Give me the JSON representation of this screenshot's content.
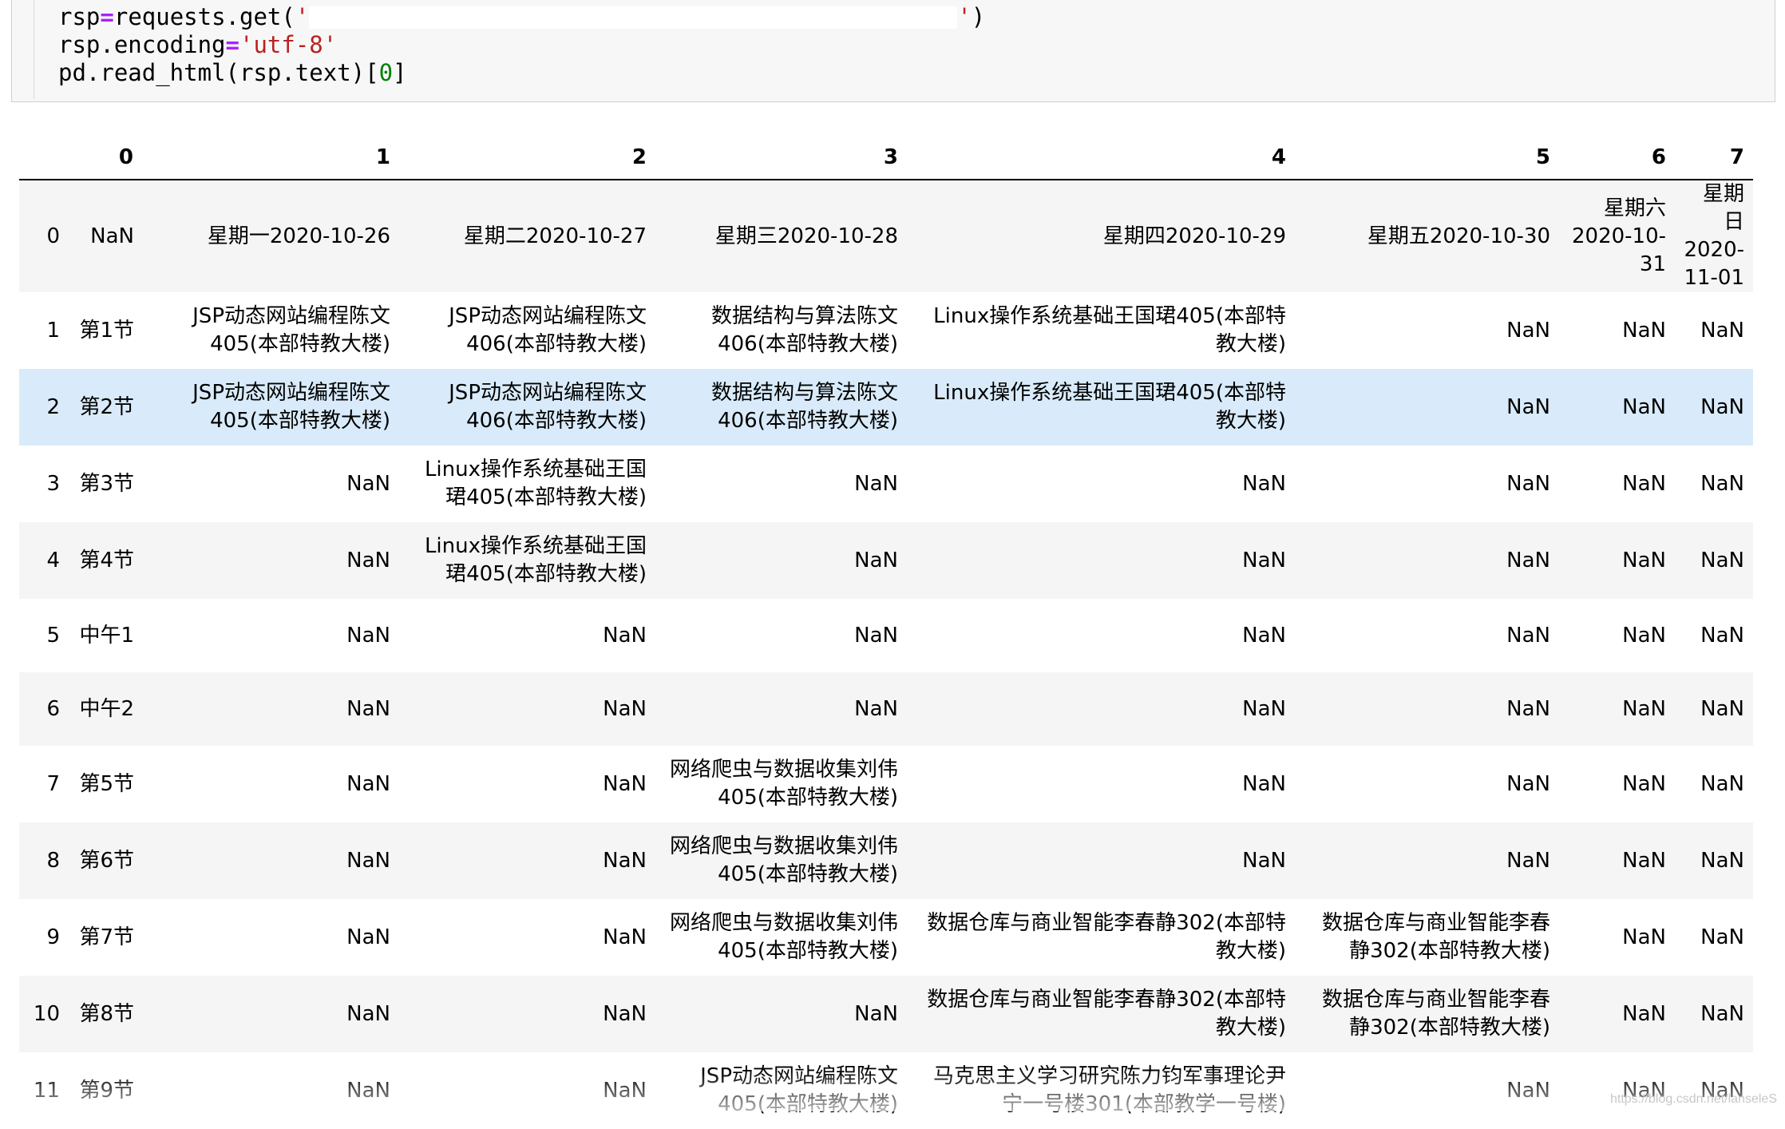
{
  "code": {
    "line1_prefix": "rsp",
    "line1_op": "=",
    "line1_call": "requests.get(",
    "line1_quote_open": "'",
    "line1_quote_close": "'",
    "line1_close": ")",
    "line2_prefix": "rsp.encoding",
    "line2_op": "=",
    "line2_str": "'utf-8'",
    "line3_call": "pd.read_html(rsp.text)[",
    "line3_num": "0",
    "line3_close": "]"
  },
  "table": {
    "columns": [
      "",
      "0",
      "1",
      "2",
      "3",
      "4",
      "5",
      "6",
      "7"
    ],
    "rows": [
      {
        "index": "0",
        "cells": [
          "NaN",
          "星期一2020-10-26",
          "星期二2020-10-27",
          "星期三2020-10-28",
          "星期四2020-10-29",
          "星期五2020-10-30",
          "星期六2020-10-31",
          "星期日2020-11-01"
        ]
      },
      {
        "index": "1",
        "cells": [
          "第1节",
          "JSP动态网站编程陈文405(本部特教大楼)",
          "JSP动态网站编程陈文406(本部特教大楼)",
          "数据结构与算法陈文406(本部特教大楼)",
          "Linux操作系统基础王国珺405(本部特教大楼)",
          "NaN",
          "NaN",
          "NaN"
        ]
      },
      {
        "index": "2",
        "cells": [
          "第2节",
          "JSP动态网站编程陈文405(本部特教大楼)",
          "JSP动态网站编程陈文406(本部特教大楼)",
          "数据结构与算法陈文406(本部特教大楼)",
          "Linux操作系统基础王国珺405(本部特教大楼)",
          "NaN",
          "NaN",
          "NaN"
        ]
      },
      {
        "index": "3",
        "cells": [
          "第3节",
          "NaN",
          "Linux操作系统基础王国珺405(本部特教大楼)",
          "NaN",
          "NaN",
          "NaN",
          "NaN",
          "NaN"
        ]
      },
      {
        "index": "4",
        "cells": [
          "第4节",
          "NaN",
          "Linux操作系统基础王国珺405(本部特教大楼)",
          "NaN",
          "NaN",
          "NaN",
          "NaN",
          "NaN"
        ]
      },
      {
        "index": "5",
        "cells": [
          "中午1",
          "NaN",
          "NaN",
          "NaN",
          "NaN",
          "NaN",
          "NaN",
          "NaN"
        ]
      },
      {
        "index": "6",
        "cells": [
          "中午2",
          "NaN",
          "NaN",
          "NaN",
          "NaN",
          "NaN",
          "NaN",
          "NaN"
        ]
      },
      {
        "index": "7",
        "cells": [
          "第5节",
          "NaN",
          "NaN",
          "网络爬虫与数据收集刘伟405(本部特教大楼)",
          "NaN",
          "NaN",
          "NaN",
          "NaN"
        ]
      },
      {
        "index": "8",
        "cells": [
          "第6节",
          "NaN",
          "NaN",
          "网络爬虫与数据收集刘伟405(本部特教大楼)",
          "NaN",
          "NaN",
          "NaN",
          "NaN"
        ]
      },
      {
        "index": "9",
        "cells": [
          "第7节",
          "NaN",
          "NaN",
          "网络爬虫与数据收集刘伟405(本部特教大楼)",
          "数据仓库与商业智能李春静302(本部特教大楼)",
          "数据仓库与商业智能李春静302(本部特教大楼)",
          "NaN",
          "NaN"
        ]
      },
      {
        "index": "10",
        "cells": [
          "第8节",
          "NaN",
          "NaN",
          "NaN",
          "数据仓库与商业智能李春静302(本部特教大楼)",
          "数据仓库与商业智能李春静302(本部特教大楼)",
          "NaN",
          "NaN"
        ]
      },
      {
        "index": "11",
        "cells": [
          "第9节",
          "NaN",
          "NaN",
          "JSP动态网站编程陈文405(本部特教大楼)",
          "马克思主义学习研究陈力钧军事理论尹宁一号楼301(本部教学一号楼)",
          "NaN",
          "NaN",
          "NaN"
        ]
      }
    ]
  },
  "watermark": "https://blog.csdn.net/lanseleS"
}
